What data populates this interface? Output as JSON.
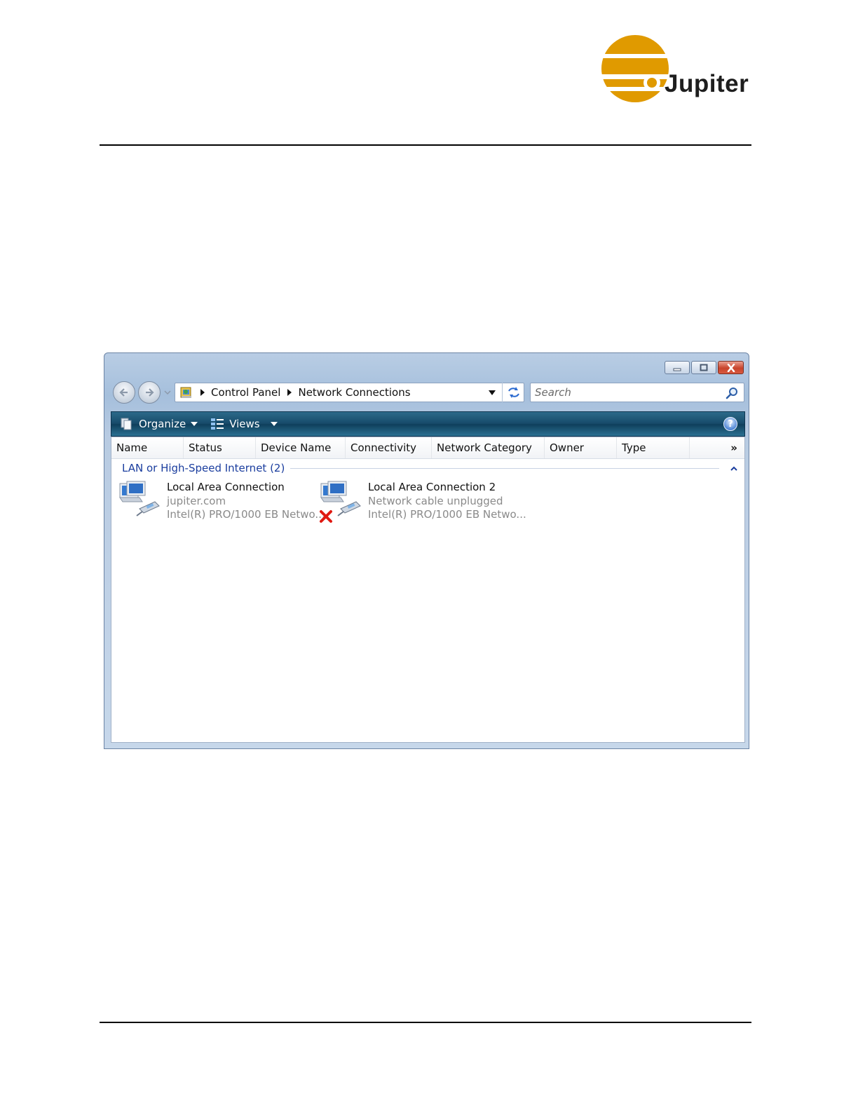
{
  "header": {
    "logo_text": "Jupiter",
    "logo_color": "#e09a00"
  },
  "window": {
    "address": {
      "crumbs": [
        "Control Panel",
        "Network Connections"
      ]
    },
    "search": {
      "placeholder": "Search"
    },
    "command_bar": {
      "organize_label": "Organize",
      "views_label": "Views",
      "help_label": "?"
    },
    "columns": [
      "Name",
      "Status",
      "Device Name",
      "Connectivity",
      "Network Category",
      "Owner",
      "Type"
    ],
    "columns_more": "»",
    "group": {
      "title": "LAN or High-Speed Internet (2)"
    },
    "connections": [
      {
        "name": "Local Area Connection",
        "status": "jupiter.com",
        "device": "Intel(R) PRO/1000 EB Netwo..."
      },
      {
        "name": "Local Area Connection 2",
        "status": "Network cable unplugged",
        "device": "Intel(R) PRO/1000 EB Netwo..."
      }
    ]
  }
}
